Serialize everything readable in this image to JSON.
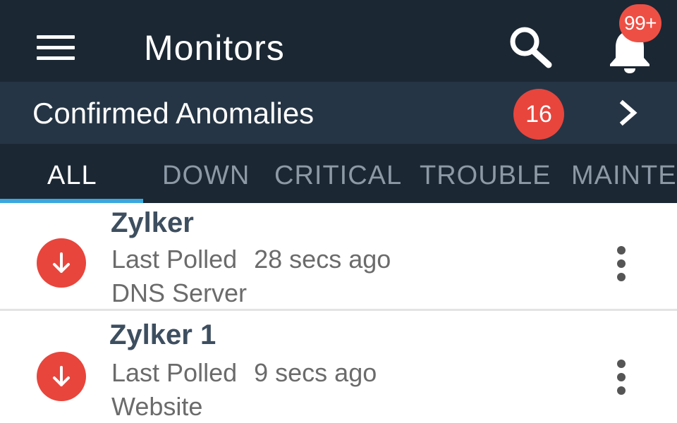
{
  "app_bar": {
    "title": "Monitors",
    "menu_icon": "hamburger-menu-icon",
    "search_icon": "search-icon",
    "notifications_icon": "bell-icon",
    "notifications_badge": "99+"
  },
  "anomalies": {
    "label": "Confirmed Anomalies",
    "count": "16",
    "arrow_icon": "chevron-right-icon"
  },
  "tabs": [
    {
      "label": "ALL",
      "active": true
    },
    {
      "label": "DOWN",
      "active": false
    },
    {
      "label": "CRITICAL",
      "active": false
    },
    {
      "label": "TROUBLE",
      "active": false
    },
    {
      "label": "MAINTE",
      "active": false
    }
  ],
  "monitors": [
    {
      "name": "Zylker",
      "last_polled_label": "Last Polled",
      "last_polled_value": "28 secs ago",
      "type": "DNS Server",
      "status": "down",
      "status_icon": "arrow-down-icon"
    },
    {
      "name": "Zylker 1",
      "last_polled_label": "Last Polled",
      "last_polled_value": "9 secs ago",
      "type": "Website",
      "status": "down",
      "status_icon": "arrow-down-icon"
    }
  ],
  "colors": {
    "app_bar_bg": "#1b2733",
    "anomalies_bg": "#253545",
    "badge_red": "#e8453c",
    "tab_indicator": "#3aa8df",
    "monitor_name": "#3d4e5f"
  }
}
